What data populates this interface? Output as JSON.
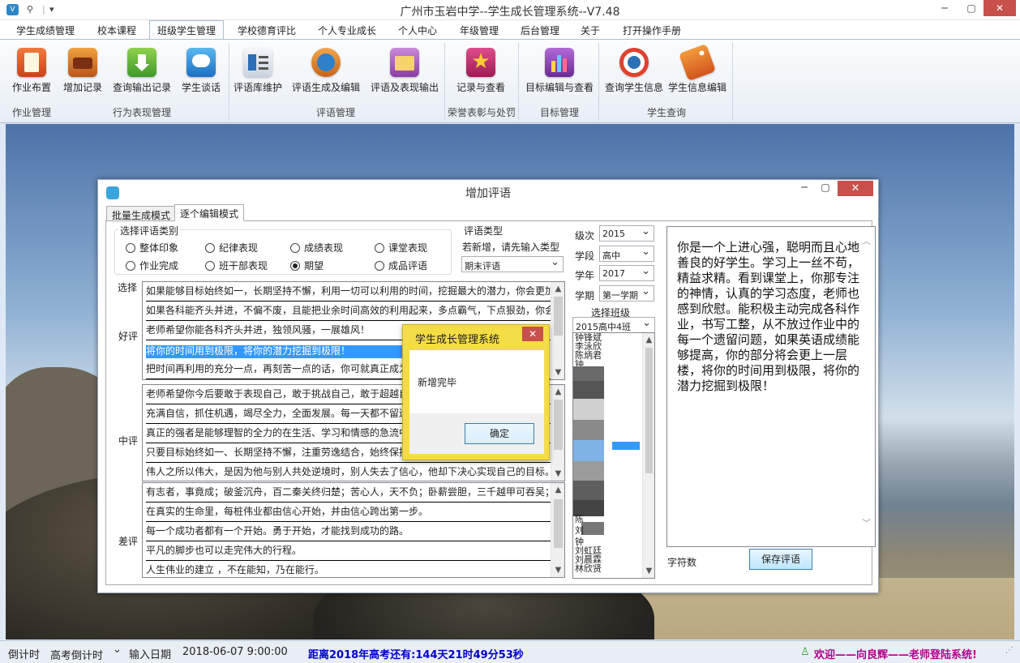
{
  "app": {
    "title": "广州市玉岩中学--学生成长管理系统--V7.48",
    "quick_access": [
      "⚲",
      "|",
      "▾"
    ]
  },
  "menu": [
    "学生成绩管理",
    "校本课程",
    "班级学生管理",
    "学校德育评比",
    "个人专业成长",
    "个人中心",
    "年级管理",
    "后台管理",
    "关于",
    "打开操作手册"
  ],
  "ribbon": {
    "buttons": [
      "作业布置",
      "增加记录",
      "查询输出记录",
      "学生谈话",
      "评语库维护",
      "评语生成及编辑",
      "评语及表现输出",
      "记录与查看",
      "目标编辑与查看",
      "查询学生信息",
      "学生信息编辑"
    ],
    "groups": [
      "作业管理",
      "行为表现管理",
      "评语管理",
      "荣誉表彰与处罚",
      "目标管理",
      "学生查询"
    ]
  },
  "dialog": {
    "title": "增加评语",
    "tabs": [
      "批量生成模式",
      "逐个编辑模式"
    ],
    "category_group": "选择评语类别",
    "categories": [
      "整体印象",
      "纪律表现",
      "成绩表现",
      "课堂表现",
      "作业完成",
      "班干部表现",
      "期望",
      "成品评语"
    ],
    "selected_category": "期望",
    "type_group": "评语类型",
    "type_hint": "若新增，请先输入类型",
    "type_value": "期末评语",
    "select_label": "选择",
    "grades": [
      "好评",
      "中评",
      "差评"
    ],
    "good_list": [
      "如果能够目标始终如一，长期坚持不懈，利用一切可以利用的时间，挖掘最大的潜力，你会更加",
      "如果各科能齐头并进，不偏不废，且能把业余时间高效的利用起来，多点霸气，下点狠劲，你会",
      "老师希望你能各科齐头并进，独领风骚，一展雄风！",
      "将你的时间用到极限，将你的潜力挖掘到极限！",
      "把时间再利用的充分一点，再刻苦一点的话，你可就真正成为"
    ],
    "mid_list": [
      "老师希望你今后要敢于表现自己，敢于挑战自己，敢于超越自",
      "充满自信，抓住机遇，竭尽全力，全面发展。每一天都不留遗",
      "真正的强者是能够理智的全力的在生活、学习和情感的急流中",
      "只要目标始终如一、长期坚持不懈，注重劳逸结合，始终保持",
      "伟人之所以伟大，是因为他与别人共处逆境时，别人失去了信心，他却下决心实现自己的目标。"
    ],
    "bad_list": [
      "有志者，事竟成；破釜沉舟，百二秦关终归楚；苦心人，天不负；卧薪尝胆，三千越甲可吞吴；",
      "在真实的生命里，每桩伟业都由信心开始，并由信心跨出第一步。",
      "每一个成功者都有一个开始。勇于开始，才能找到成功的路。",
      "平凡的脚步也可以走完伟大的行程。",
      "人生伟业的建立 ，不在能知，乃在能行。"
    ],
    "filters": [
      {
        "label": "级次",
        "value": "2015"
      },
      {
        "label": "学段",
        "value": "高中"
      },
      {
        "label": "学年",
        "value": "2017"
      },
      {
        "label": "学期",
        "value": "第一学期"
      }
    ],
    "class_label": "选择班级",
    "class_value": "2015高中4班",
    "students_top": [
      "钟锋斌",
      "李泳欣",
      "陈炳君",
      "钟"
    ],
    "students_bottom": [
      "陈",
      "刘",
      "钟",
      "刘虹廷",
      "刘晨霖",
      "林欣贤"
    ],
    "comment_text": "你是一个上进心强，聪明而且心地善良的好学生。学习上一丝不苟，精益求精。看到课堂上，你那专注的神情，认真的学习态度，老师也感到欣慰。能积极主动完成各科作业，书写工整，从不放过作业中的每一个遗留问题，如果英语成绩能够提高，你的部分将会更上一层楼，将你的时间用到极限，将你的潜力挖掘到极限！",
    "char_count_label": "字符数",
    "save_button": "保存评语"
  },
  "message": {
    "title": "学生成长管理系统",
    "text": "新增完毕",
    "ok": "确定"
  },
  "statusbar": {
    "countdown_label": "倒计时",
    "countdown_select": "高考倒计时",
    "input_date_label": "输入日期",
    "date_value": "2018-06-07  9:00:00",
    "countdown_text": "距离2018年高考还有:144天21时49分53秒",
    "welcome": "欢迎——向良辉——老师登陆系统!"
  },
  "colors": {
    "selection": "#3399ff",
    "countdown": "#0000cc",
    "welcome": "#b0008c",
    "close": "#c7504a",
    "msgbox": "#f4dc44"
  }
}
